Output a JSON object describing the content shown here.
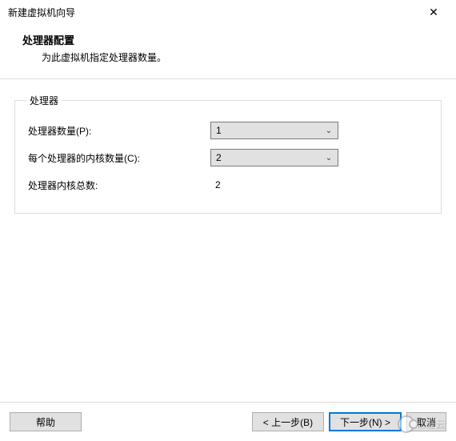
{
  "window": {
    "title": "新建虚拟机向导"
  },
  "header": {
    "title": "处理器配置",
    "subtitle": "为此虚拟机指定处理器数量。"
  },
  "group": {
    "legend": "处理器",
    "rows": {
      "proc_count_label": "处理器数量(P):",
      "proc_count_value": "1",
      "cores_per_label": "每个处理器的内核数量(C):",
      "cores_per_value": "2",
      "total_cores_label": "处理器内核总数:",
      "total_cores_value": "2"
    }
  },
  "footer": {
    "help": "帮助",
    "back": "< 上一步(B)",
    "next": "下一步(N) >",
    "cancel": "取消"
  },
  "watermark": "亿速云"
}
